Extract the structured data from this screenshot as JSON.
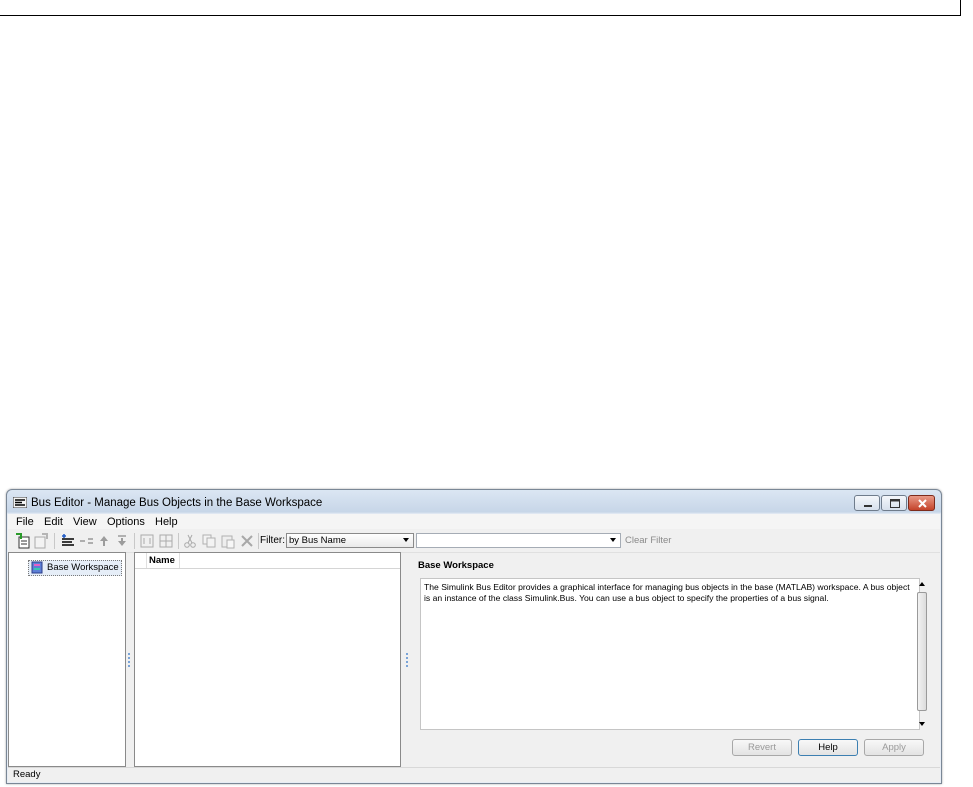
{
  "window": {
    "title": "Bus Editor - Manage Bus Objects in the Base Workspace"
  },
  "menubar": {
    "items": [
      "File",
      "Edit",
      "View",
      "Options",
      "Help"
    ]
  },
  "toolbar": {
    "icons": [
      "import-icon",
      "export-icon",
      "add-bus-icon",
      "insert-bus-element-icon",
      "move-up-icon",
      "move-down-icon",
      "create-subsystem-icon",
      "create-matlab-struct-icon",
      "cut-icon",
      "copy-icon",
      "paste-icon",
      "delete-icon"
    ],
    "filter_label": "Filter:",
    "filter_mode": "by Bus Name",
    "filter_value": "",
    "clear_filter_label": "Clear Filter"
  },
  "tree": {
    "root_label": "Base Workspace",
    "root_icon": "workspace-icon"
  },
  "list": {
    "columns": [
      "Name"
    ],
    "rows": []
  },
  "details": {
    "title": "Base Workspace",
    "description": "The Simulink Bus Editor provides a graphical interface for managing bus objects in the base (MATLAB) workspace. A bus object is an instance of the class Simulink.Bus. You can use a bus object to specify the properties of a bus signal.",
    "buttons": {
      "revert": "Revert",
      "help": "Help",
      "apply": "Apply"
    }
  },
  "status": {
    "text": "Ready"
  }
}
